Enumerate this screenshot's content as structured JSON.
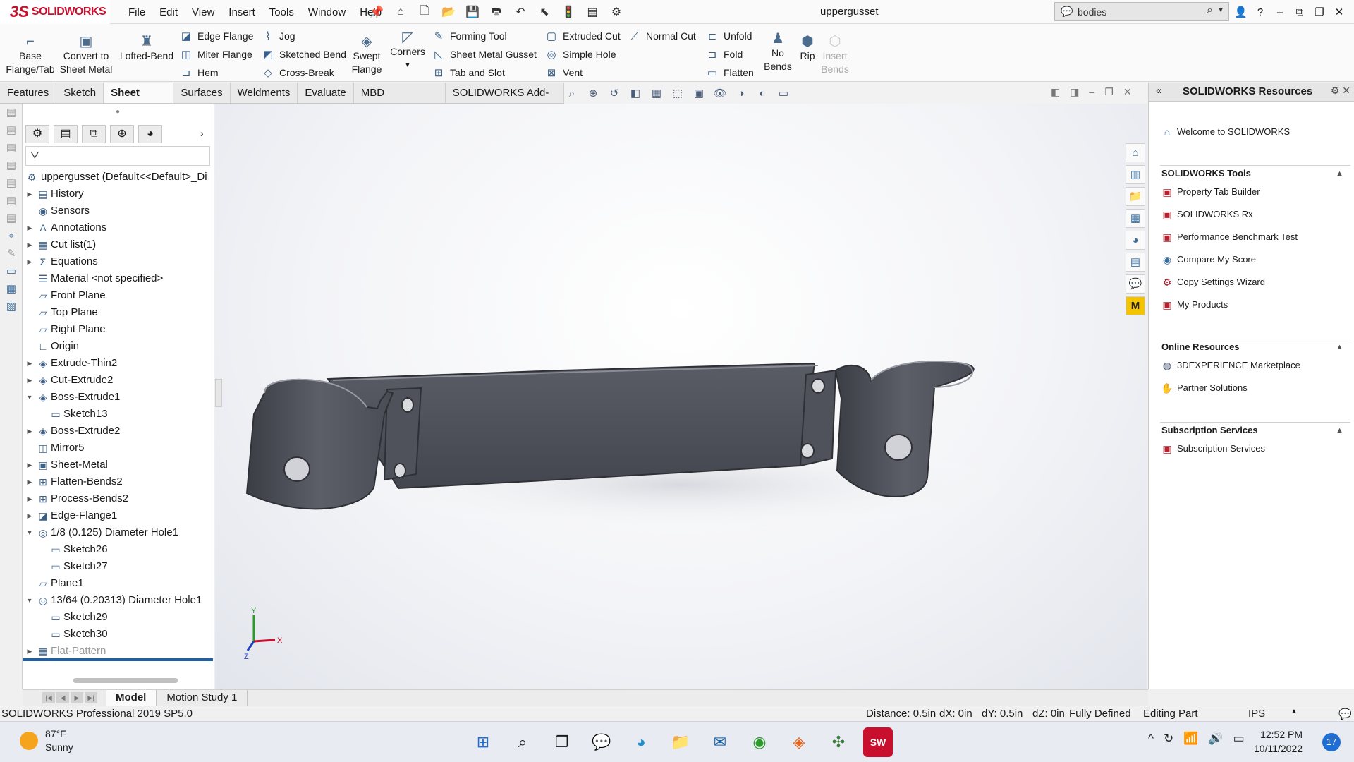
{
  "app": {
    "brand": "SOLIDWORKS",
    "brand_prefix": "3S",
    "document_title": "uppergusset"
  },
  "menu": [
    "File",
    "Edit",
    "View",
    "Insert",
    "Tools",
    "Window",
    "Help"
  ],
  "search": {
    "value": "bodies"
  },
  "ribbon": {
    "base_flange": "Base\nFlange/Tab",
    "convert": "Convert to\nSheet Metal",
    "lofted_bend": "Lofted-Bend",
    "edge_flange": "Edge Flange",
    "miter_flange": "Miter Flange",
    "hem": "Hem",
    "jog": "Jog",
    "sketched_bend": "Sketched Bend",
    "cross_break": "Cross-Break",
    "swept_flange": "Swept\nFlange",
    "corners": "Corners",
    "forming_tool": "Forming Tool",
    "gusset": "Sheet Metal Gusset",
    "tab_slot": "Tab and Slot",
    "extruded_cut": "Extruded Cut",
    "simple_hole": "Simple Hole",
    "vent": "Vent",
    "normal_cut": "Normal Cut",
    "unfold": "Unfold",
    "fold": "Fold",
    "flatten": "Flatten",
    "no_bends": "No\nBends",
    "rip": "Rip",
    "insert_bends": "Insert\nBends"
  },
  "tabs": [
    "Features",
    "Sketch",
    "Sheet Metal",
    "Surfaces",
    "Weldments",
    "Evaluate",
    "MBD Dimensions",
    "SOLIDWORKS Add-Ins"
  ],
  "active_tab": "Sheet Metal",
  "tree": {
    "root": "uppergusset  (Default<<Default>_Di",
    "items": [
      {
        "label": "History",
        "level": 1,
        "exp": "right",
        "icon": "history-icon"
      },
      {
        "label": "Sensors",
        "level": 1,
        "exp": "",
        "icon": "sensor-icon"
      },
      {
        "label": "Annotations",
        "level": 1,
        "exp": "right",
        "icon": "annotation-icon"
      },
      {
        "label": "Cut list(1)",
        "level": 1,
        "exp": "right",
        "icon": "cutlist-icon"
      },
      {
        "label": "Equations",
        "level": 1,
        "exp": "right",
        "icon": "equation-icon"
      },
      {
        "label": "Material <not specified>",
        "level": 1,
        "exp": "",
        "icon": "material-icon"
      },
      {
        "label": "Front Plane",
        "level": 1,
        "exp": "",
        "icon": "plane-icon"
      },
      {
        "label": "Top Plane",
        "level": 1,
        "exp": "",
        "icon": "plane-icon"
      },
      {
        "label": "Right Plane",
        "level": 1,
        "exp": "",
        "icon": "plane-icon"
      },
      {
        "label": "Origin",
        "level": 1,
        "exp": "",
        "icon": "origin-icon"
      },
      {
        "label": "Extrude-Thin2",
        "level": 1,
        "exp": "right",
        "icon": "feature-icon"
      },
      {
        "label": "Cut-Extrude2",
        "level": 1,
        "exp": "right",
        "icon": "feature-icon"
      },
      {
        "label": "Boss-Extrude1",
        "level": 1,
        "exp": "down",
        "icon": "feature-icon"
      },
      {
        "label": "Sketch13",
        "level": 2,
        "exp": "",
        "icon": "sketch-icon"
      },
      {
        "label": "Boss-Extrude2",
        "level": 1,
        "exp": "right",
        "icon": "feature-icon"
      },
      {
        "label": "Mirror5",
        "level": 1,
        "exp": "",
        "icon": "mirror-icon"
      },
      {
        "label": "Sheet-Metal",
        "level": 1,
        "exp": "right",
        "icon": "sheetmetal-icon"
      },
      {
        "label": "Flatten-Bends2",
        "level": 1,
        "exp": "right",
        "icon": "flatten-icon"
      },
      {
        "label": "Process-Bends2",
        "level": 1,
        "exp": "right",
        "icon": "flatten-icon"
      },
      {
        "label": "Edge-Flange1",
        "level": 1,
        "exp": "right",
        "icon": "flange-icon"
      },
      {
        "label": "1/8 (0.125) Diameter Hole1",
        "level": 1,
        "exp": "down",
        "icon": "hole-icon"
      },
      {
        "label": "Sketch26",
        "level": 2,
        "exp": "",
        "icon": "sketch-icon"
      },
      {
        "label": "Sketch27",
        "level": 2,
        "exp": "",
        "icon": "sketch-icon"
      },
      {
        "label": "Plane1",
        "level": 1,
        "exp": "",
        "icon": "plane-icon"
      },
      {
        "label": "13/64 (0.20313) Diameter Hole1",
        "level": 1,
        "exp": "down",
        "icon": "hole-icon"
      },
      {
        "label": "Sketch29",
        "level": 2,
        "exp": "",
        "icon": "sketch-icon"
      },
      {
        "label": "Sketch30",
        "level": 2,
        "exp": "",
        "icon": "sketch-icon"
      },
      {
        "label": "Flat-Pattern",
        "level": 1,
        "exp": "right",
        "icon": "flatpattern-icon",
        "dim": true
      }
    ]
  },
  "bottom_tabs": [
    "Model",
    "Motion Study 1"
  ],
  "triad": {
    "x": "X",
    "y": "Y",
    "z": "Z"
  },
  "taskpane": {
    "title": "SOLIDWORKS Resources",
    "welcome": "Welcome to SOLIDWORKS",
    "sections": [
      {
        "title": "SOLIDWORKS Tools",
        "items": [
          "Property Tab Builder",
          "SOLIDWORKS Rx",
          "Performance Benchmark Test",
          "Compare My Score",
          "Copy Settings Wizard",
          "My Products"
        ]
      },
      {
        "title": "Online Resources",
        "items": [
          "3DEXPERIENCE Marketplace",
          "Partner Solutions"
        ]
      },
      {
        "title": "Subscription Services",
        "items": [
          "Subscription Services"
        ]
      }
    ]
  },
  "status": {
    "product": "SOLIDWORKS Professional 2019 SP5.0",
    "distance": "Distance: 0.5in",
    "dx": "dX: 0in",
    "dy": "dY: 0.5in",
    "dz": "dZ: 0in",
    "defined": "Fully Defined",
    "mode": "Editing Part",
    "units": "IPS"
  },
  "taskbar": {
    "temp": "87°F",
    "condition": "Sunny",
    "time": "12:52 PM",
    "date": "10/11/2022",
    "notifications": "17"
  },
  "colors": {
    "brand": "#c8102e",
    "part": "#4e505a",
    "accent": "#1d5fa8"
  }
}
